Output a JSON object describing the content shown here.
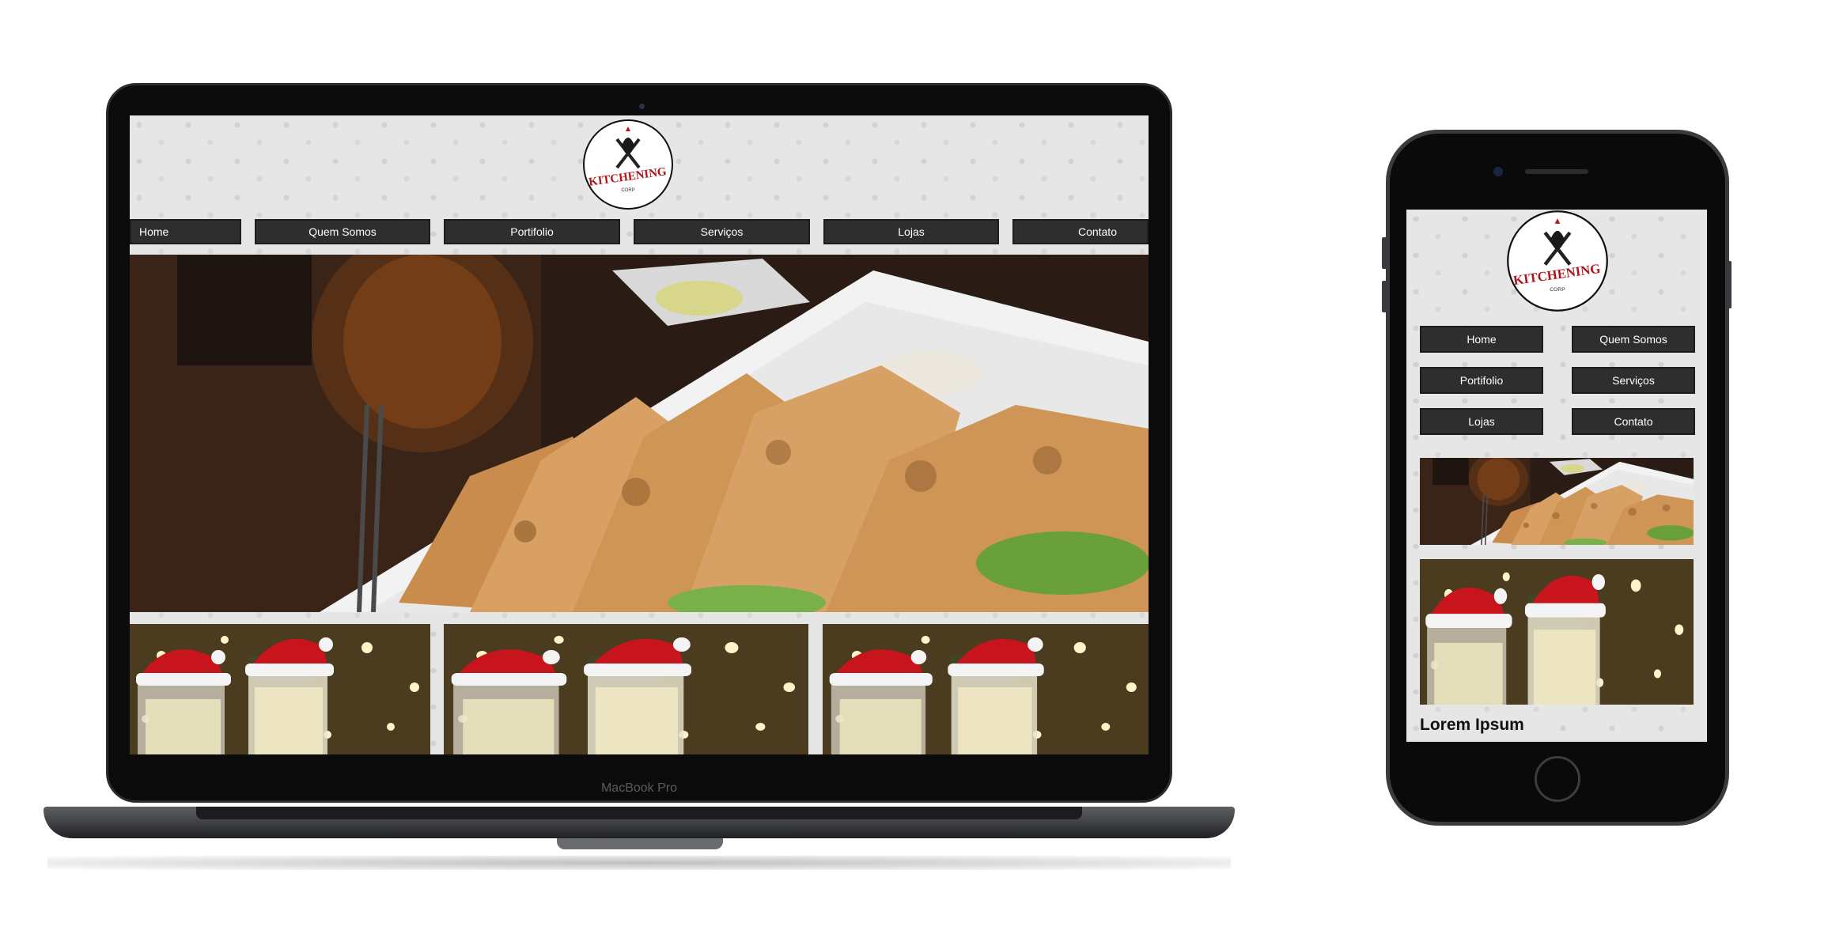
{
  "laptop": {
    "model_label": "MacBook Pro",
    "site": {
      "logo_text": "KITCHENING",
      "logo_subtext": "CORP",
      "nav": [
        {
          "label": "Home",
          "align": "left"
        },
        {
          "label": "Quem Somos",
          "align": "center"
        },
        {
          "label": "Portifolio",
          "align": "center"
        },
        {
          "label": "Serviços",
          "align": "center"
        },
        {
          "label": "Lojas",
          "align": "center"
        },
        {
          "label": "Contato",
          "align": "right"
        }
      ]
    }
  },
  "phone": {
    "site": {
      "logo_text": "KITCHENING",
      "logo_subtext": "CORP",
      "nav": [
        {
          "label": "Home"
        },
        {
          "label": "Quem Somos"
        },
        {
          "label": "Portifolio"
        },
        {
          "label": "Serviços"
        },
        {
          "label": "Lojas"
        },
        {
          "label": "Contato"
        }
      ],
      "heading": "Lorem Ipsum"
    }
  },
  "colors": {
    "nav_button_bg": "#2e2e2e",
    "page_bg": "#e6e6e6",
    "logo_red": "#b3141c"
  }
}
